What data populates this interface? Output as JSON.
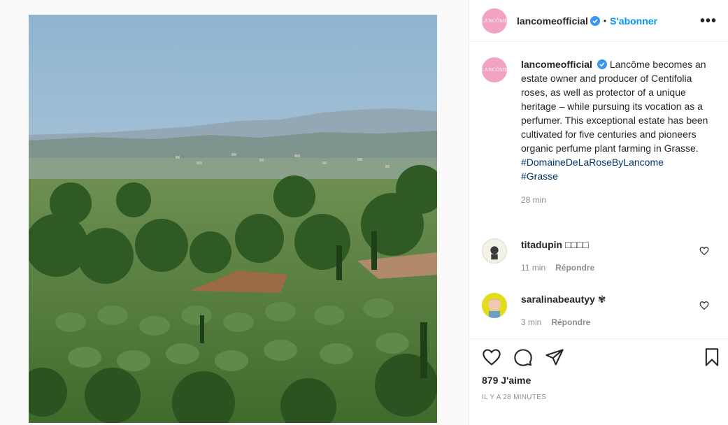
{
  "post": {
    "image_alt": "Olive groves and hills near Grasse",
    "author": "lancomeofficial",
    "avatar_text": "LANCÔME",
    "follow_label": "S'abonner",
    "dot": "•",
    "more_icon": "more-horizontal-icon"
  },
  "caption": {
    "username": "lancomeofficial",
    "text": "Lancôme becomes an estate owner and producer of Centifolia roses, as well as protector of a unique heritage – while pursuing its vocation as a perfumer. This exceptional estate has been cultivated for five centuries and pioneers organic perfume plant farming in Grasse.",
    "hashtags": [
      "#DomaineDeLaRoseByLancome",
      "#Grasse"
    ],
    "time": "28 min"
  },
  "comments": [
    {
      "username": "titadupin",
      "text": "□□□□",
      "time": "11 min",
      "reply": "Répondre"
    },
    {
      "username": "saralinabeautyy",
      "text": "✾",
      "time": "3 min",
      "reply": "Répondre"
    }
  ],
  "actions": {
    "likes": "879 J'aime",
    "date": "IL Y A 28 MINUTES"
  },
  "colors": {
    "link": "#0095f6",
    "hashtag": "#00376b",
    "muted": "#8e8e8e",
    "brand_pink": "#f2a3c4"
  }
}
